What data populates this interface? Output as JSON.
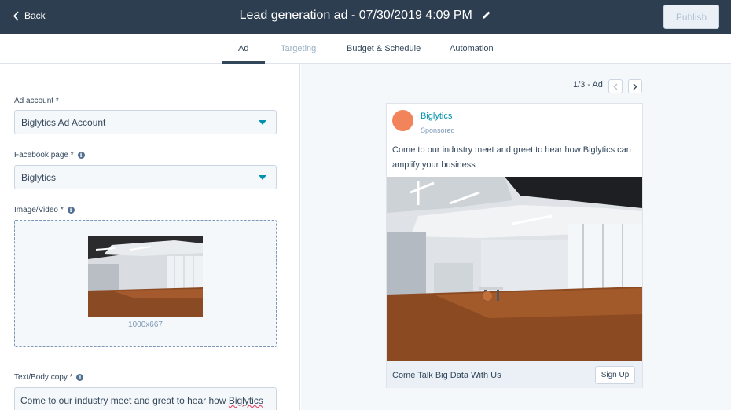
{
  "header": {
    "back_label": "Back",
    "title": "Lead generation ad - 07/30/2019 4:09 PM",
    "publish_label": "Publish"
  },
  "tabs": [
    {
      "label": "Ad",
      "active": true
    },
    {
      "label": "Targeting",
      "disabled": true
    },
    {
      "label": "Budget & Schedule"
    },
    {
      "label": "Automation"
    }
  ],
  "form": {
    "ad_account": {
      "label": "Ad account *",
      "value": "Biglytics Ad Account"
    },
    "facebook_page": {
      "label": "Facebook page *",
      "value": "Biglytics"
    },
    "image_video": {
      "label": "Image/Video *",
      "dimensions": "1000x667"
    },
    "body_copy": {
      "label": "Text/Body copy *",
      "value_prefix": "Come to our industry meet and great to hear how ",
      "value_flagged": "Biglytics"
    }
  },
  "preview": {
    "pager": "1/3 - Ad",
    "page_name": "Biglytics",
    "sponsored": "Sponsored",
    "body": "Come to our industry meet and greet to hear how Biglytics can amplify your business",
    "headline": "Come Talk Big Data With Us",
    "cta": "Sign Up",
    "avatar_color": "#f2845c"
  },
  "colors": {
    "header_bg": "#2d3e50",
    "accent": "#0091ae",
    "panel_bg": "#f5f8fa"
  }
}
